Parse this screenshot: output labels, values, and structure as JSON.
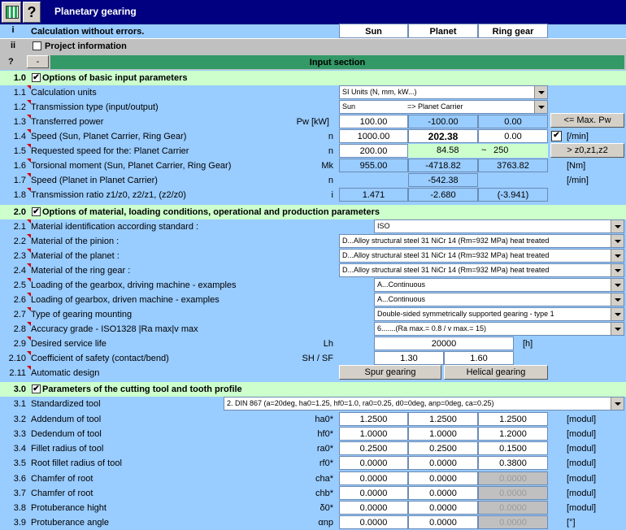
{
  "title": "Planetary gearing",
  "header": {
    "row_i_marker": "i",
    "status": "Calculation without errors.",
    "col_sun": "Sun",
    "col_planet": "Planet",
    "col_ring": "Ring gear",
    "row_ii_marker": "ii",
    "project_info": "Project information",
    "q_marker": "?",
    "dash_button": "-",
    "input_section": "Input section"
  },
  "s1": {
    "num": "1.0",
    "title": "Options of basic input parameters",
    "rows": [
      {
        "num": "1.1",
        "label": "Calculation units",
        "combo": "SI Units (N, mm, kW...)"
      },
      {
        "num": "1.2",
        "label": "Transmission type (input/output)",
        "combo_a": "Sun",
        "combo_b": "=> Planet Carrier"
      },
      {
        "num": "1.3",
        "label": "Transferred power",
        "sym": "Pw [kW]",
        "v1": "100.00",
        "v2": "-100.00",
        "v3": "0.00",
        "btn": "<= Max. Pw"
      },
      {
        "num": "1.4",
        "label": "Speed (Sun, Planet Carrier, Ring Gear)",
        "sym": "n",
        "v1": "1000.00",
        "v2": "202.38",
        "v3": "0.00",
        "unit": "[/min]"
      },
      {
        "num": "1.5",
        "label": "Requested speed for the: Planet Carrier",
        "sym": "n",
        "v1": "200.00",
        "range_lo": "84.58",
        "range_sep": "~",
        "range_hi": "250",
        "btn": "> z0,z1,z2"
      },
      {
        "num": "1.6",
        "label": "Torsional moment (Sun, Planet Carrier, Ring Gear)",
        "sym": "Mk",
        "v1": "955.00",
        "v2": "-4718.82",
        "v3": "3763.82",
        "unit": "[Nm]"
      },
      {
        "num": "1.7",
        "label": "Speed (Planet in Planet Carrier)",
        "sym": "n",
        "v2": "-542.38",
        "unit": "[/min]"
      },
      {
        "num": "1.8",
        "label": "Transmission ratio z1/z0, z2/z1, (z2/z0)",
        "sym": "i",
        "v1": "1.471",
        "v2": "-2.680",
        "v3": "(-3.941)"
      }
    ]
  },
  "s2": {
    "num": "2.0",
    "title": "Options of material, loading conditions, operational and production parameters",
    "rows": [
      {
        "num": "2.1",
        "label": "Material identification according standard :",
        "combo": "ISO"
      },
      {
        "num": "2.2",
        "label": "Material of the pinion :",
        "combo": "D...Alloy structural steel 31 NiCr 14 (Rm=932 MPa) heat treated"
      },
      {
        "num": "2.3",
        "label": "Material of the planet :",
        "combo": "D...Alloy structural steel 31 NiCr 14 (Rm=932 MPa) heat treated"
      },
      {
        "num": "2.4",
        "label": "Material of the ring gear :",
        "combo": "D...Alloy structural steel 31 NiCr 14 (Rm=932 MPa) heat treated"
      },
      {
        "num": "2.5",
        "label": "Loading of the gearbox, driving machine - examples",
        "combo": "A...Continuous"
      },
      {
        "num": "2.6",
        "label": "Loading of gearbox, driven machine - examples",
        "combo": "A...Continuous"
      },
      {
        "num": "2.7",
        "label": "Type of gearing mounting",
        "combo": "Double-sided symmetrically supported gearing - type 1"
      },
      {
        "num": "2.8",
        "label": "Accuracy grade - ISO1328 |Ra max|v max",
        "combo": "6.......(Ra max.= 0.8 / v max.= 15)"
      },
      {
        "num": "2.9",
        "label": "Desired service life",
        "sym": "Lh",
        "v": "20000",
        "unit": "[h]"
      },
      {
        "num": "2.10",
        "label": "Coefficient of safety (contact/bend)",
        "sym": "SH / SF",
        "v1": "1.30",
        "v2": "1.60"
      },
      {
        "num": "2.11",
        "label": "Automatic design",
        "btn1": "Spur gearing",
        "btn2": "Helical gearing"
      }
    ]
  },
  "s3": {
    "num": "3.0",
    "title": "Parameters of the cutting tool and tooth profile",
    "rows": [
      {
        "num": "3.1",
        "label": "Standardized tool",
        "combo": "2. DIN 867 (a=20deg, ha0=1.25, hf0=1.0, ra0=0.25, d0=0deg, anp=0deg, ca=0.25)"
      },
      {
        "num": "3.2",
        "label": "Addendum of tool",
        "sym": "ha0*",
        "v1": "1.2500",
        "v2": "1.2500",
        "v3": "1.2500",
        "unit": "[modul]"
      },
      {
        "num": "3.3",
        "label": "Dedendum of tool",
        "sym": "hf0*",
        "v1": "1.0000",
        "v2": "1.0000",
        "v3": "1.2000",
        "unit": "[modul]"
      },
      {
        "num": "3.4",
        "label": "Fillet radius of tool",
        "sym": "ra0*",
        "v1": "0.2500",
        "v2": "0.2500",
        "v3": "0.1500",
        "unit": "[modul]"
      },
      {
        "num": "3.5",
        "label": "Root fillet radius of tool",
        "sym": "rf0*",
        "v1": "0.0000",
        "v2": "0.0000",
        "v3": "0.3800",
        "unit": "[modul]"
      },
      {
        "num": "3.6",
        "label": "Chamfer of root",
        "sym": "cha*",
        "v1": "0.0000",
        "v2": "0.0000",
        "v3": "0.0000",
        "unit": "[modul]"
      },
      {
        "num": "3.7",
        "label": "Chamfer of root",
        "sym": "chb*",
        "v1": "0.0000",
        "v2": "0.0000",
        "v3": "0.0000",
        "unit": "[modul]"
      },
      {
        "num": "3.8",
        "label": "Protuberance hight",
        "sym": "δ0*",
        "v1": "0.0000",
        "v2": "0.0000",
        "v3": "0.0000",
        "unit": "[modul]"
      },
      {
        "num": "3.9",
        "label": "Protuberance angle",
        "sym": "αnp",
        "v1": "0.0000",
        "v2": "0.0000",
        "v3": "0.0000",
        "unit": "[°]"
      }
    ]
  }
}
